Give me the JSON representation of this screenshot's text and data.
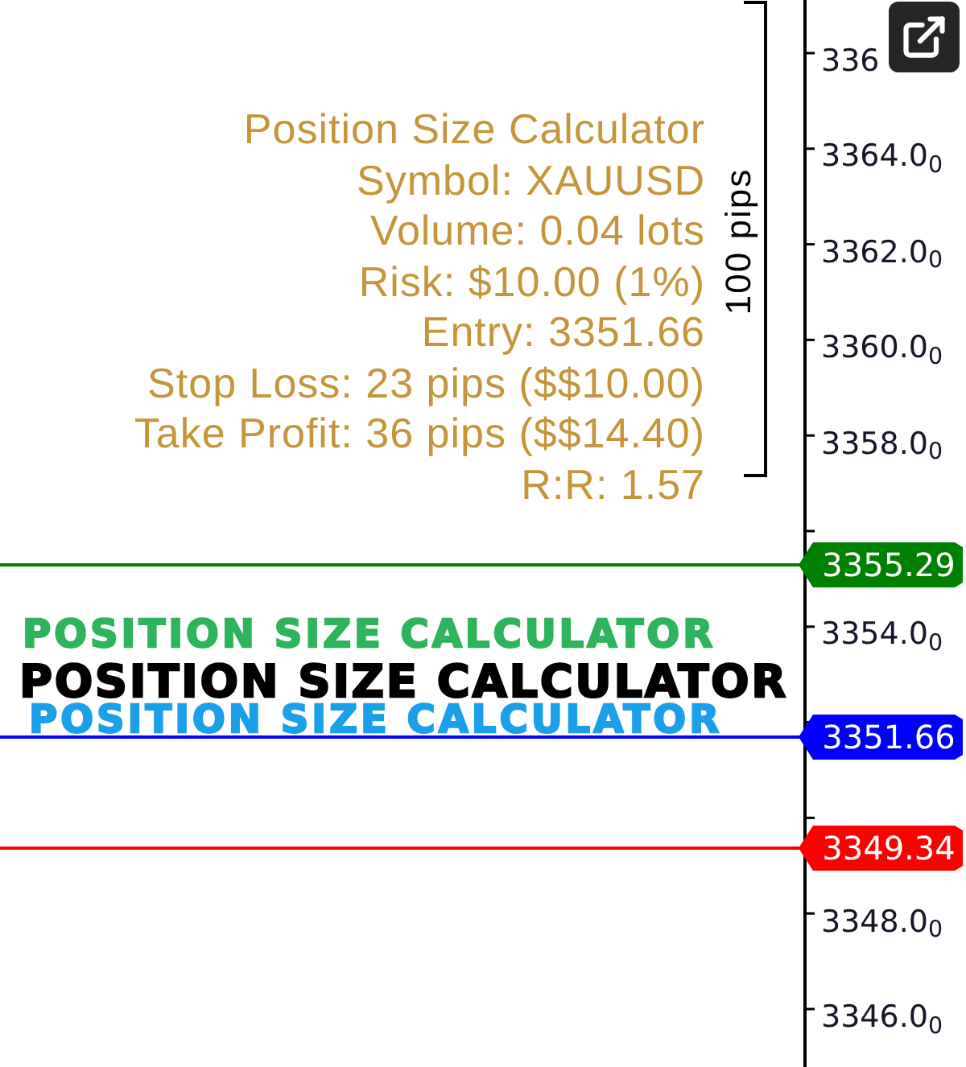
{
  "info_panel": {
    "title": "Position Size Calculator",
    "lines": [
      "Symbol: XAUUSD",
      "Volume: 0.04 lots",
      "Risk: $10.00 (1%)",
      "Entry: 3351.66",
      "Stop Loss: 23 pips ($$10.00)",
      "Take Profit: 36 pips ($$14.40)",
      "R:R: 1.57"
    ]
  },
  "range_marker": {
    "label": "100 pips"
  },
  "price_axis": {
    "labels": [
      "336",
      "3364.0$_{0}$",
      "3362.0$_{0}$",
      "3360.0$_{0}$",
      "3358.0$_{0}$",
      "3354.0$_{0}$",
      "3348.0$_{0}$",
      "3346.0$_{0}$"
    ]
  },
  "levels": [
    {
      "price": "3355.29",
      "color": "#008000"
    },
    {
      "price": "3351.66",
      "color": "#0000ff"
    },
    {
      "price": "3349.34",
      "color": "#ff0000"
    }
  ],
  "logo_lines": [
    {
      "text": "POSITION SIZE CALCULATOR",
      "color": "#2eb45a"
    },
    {
      "text": "POSITION SIZE CALCULATOR",
      "color": "#000000"
    },
    {
      "text": "POSITION SIZE CALCULATOR",
      "color": "#1aa0e8"
    }
  ]
}
